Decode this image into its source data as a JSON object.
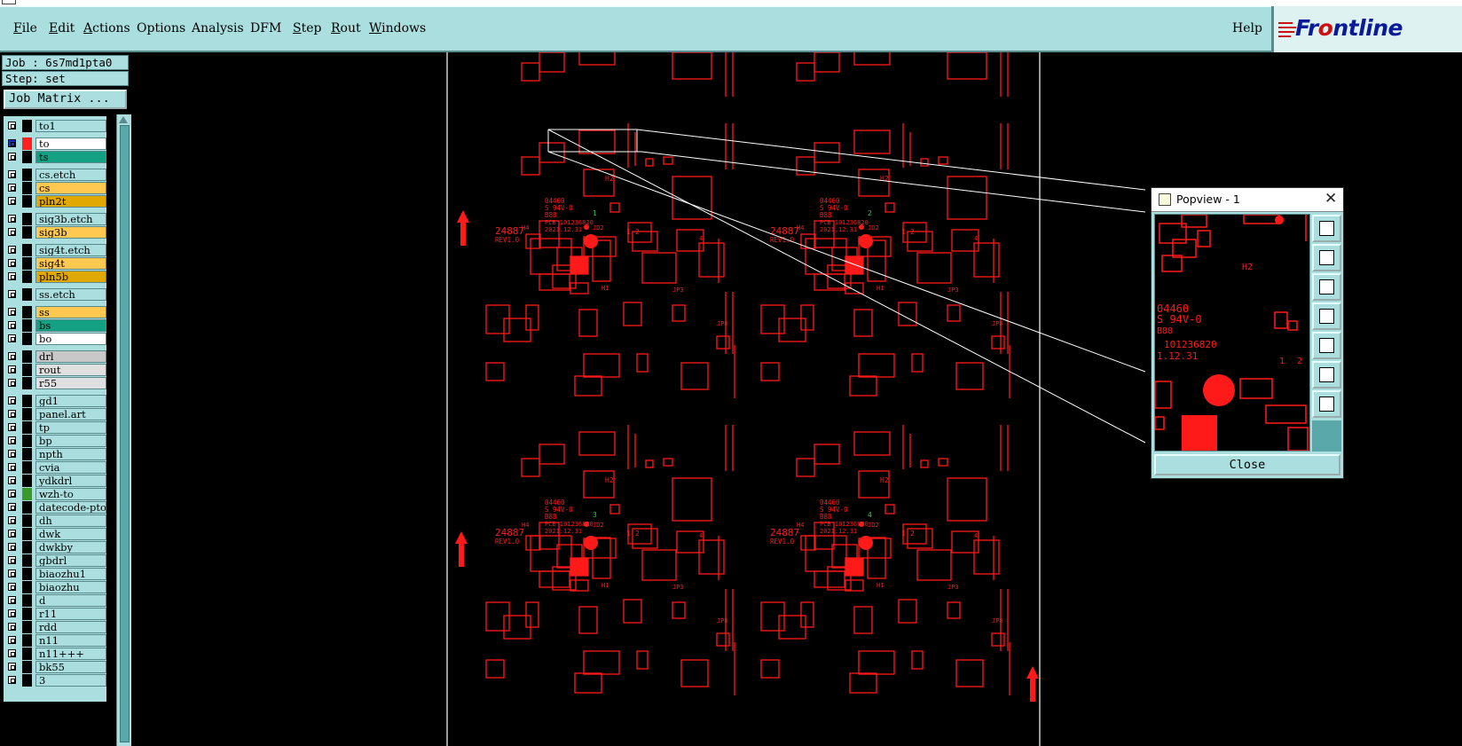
{
  "menu": {
    "items": [
      "File",
      "Edit",
      "Actions",
      "Options",
      "Analysis",
      "DFM",
      "Step",
      "Rout",
      "Windows"
    ],
    "help": "Help",
    "logo": "Frontline"
  },
  "job": {
    "job_line": "Job : 6s7md1pta0",
    "step_line": "Step: set",
    "matrix_button": "Job Matrix ..."
  },
  "layers": [
    {
      "name": "to1",
      "color": "#aadedf"
    },
    {
      "name": "to",
      "color": "#ffffff",
      "active": true,
      "swatch": "#ff2020"
    },
    {
      "name": "ts",
      "color": "#13a083"
    },
    {
      "name": "cs.etch",
      "color": "#aadedf"
    },
    {
      "name": "cs",
      "color": "#ffc850"
    },
    {
      "name": "pln2t",
      "color": "#e0a800"
    },
    {
      "name": "sig3b.etch",
      "color": "#aadedf"
    },
    {
      "name": "sig3b",
      "color": "#ffc850"
    },
    {
      "name": "sig4t.etch",
      "color": "#aadedf"
    },
    {
      "name": "sig4t",
      "color": "#ffc850"
    },
    {
      "name": "pln5b",
      "color": "#e0a800"
    },
    {
      "name": "ss.etch",
      "color": "#aadedf"
    },
    {
      "name": "ss",
      "color": "#ffc850"
    },
    {
      "name": "bs",
      "color": "#13a083"
    },
    {
      "name": "bo",
      "color": "#ffffff"
    },
    {
      "name": "drl",
      "color": "#c8c8c8"
    },
    {
      "name": "rout",
      "color": "#e0e0e0"
    },
    {
      "name": "r55",
      "color": "#e0e0e0"
    },
    {
      "name": "gd1",
      "color": "#aadedf"
    },
    {
      "name": "panel.art",
      "color": "#aadedf"
    },
    {
      "name": "tp",
      "color": "#aadedf"
    },
    {
      "name": "bp",
      "color": "#aadedf"
    },
    {
      "name": "npth",
      "color": "#aadedf"
    },
    {
      "name": "cvia",
      "color": "#aadedf"
    },
    {
      "name": "ydkdrl",
      "color": "#aadedf"
    },
    {
      "name": "wzh-to",
      "color": "#aadedf",
      "swatch": "#3a9a2a"
    },
    {
      "name": "datecode-pto",
      "color": "#aadedf"
    },
    {
      "name": "dh",
      "color": "#aadedf"
    },
    {
      "name": "dwk",
      "color": "#aadedf"
    },
    {
      "name": "dwkby",
      "color": "#aadedf"
    },
    {
      "name": "gbdrl",
      "color": "#aadedf"
    },
    {
      "name": "biaozhu1",
      "color": "#aadedf"
    },
    {
      "name": "biaozhu",
      "color": "#aadedf"
    },
    {
      "name": "d",
      "color": "#aadedf"
    },
    {
      "name": "r11",
      "color": "#aadedf"
    },
    {
      "name": "rdd",
      "color": "#aadedf"
    },
    {
      "name": "n11",
      "color": "#aadedf"
    },
    {
      "name": "n11+++",
      "color": "#aadedf"
    },
    {
      "name": "bk55",
      "color": "#aadedf"
    },
    {
      "name": "3",
      "color": "#aadedf"
    }
  ],
  "board": {
    "cell_labels": [
      "H4",
      "JD2",
      "H1",
      "JP3",
      "H2",
      "JP42",
      "JP8"
    ],
    "date_block": [
      "04460",
      "S 94V-0",
      "B88",
      "PCB 101236820",
      "2021.12.31"
    ],
    "code_block": [
      "24887",
      "REV1.0"
    ],
    "panel_numbers": [
      "1",
      "2",
      "3",
      "4"
    ],
    "trace_color": "#ff1a1a",
    "marker_color": "#2ecc40"
  },
  "popview": {
    "title": "Popview - 1",
    "close_x": "✕",
    "close_label": "Close",
    "texts": [
      "H2",
      "04460",
      "S 94V-0",
      "B88",
      "101236820",
      "1.12.31",
      "1",
      "2"
    ],
    "tools": [
      "zoom-home-icon",
      "pan-up-icon",
      "pan-down-icon",
      "pan-left-icon",
      "pan-right-icon",
      "zoom-fit-icon",
      "zoom-reset-icon"
    ]
  }
}
